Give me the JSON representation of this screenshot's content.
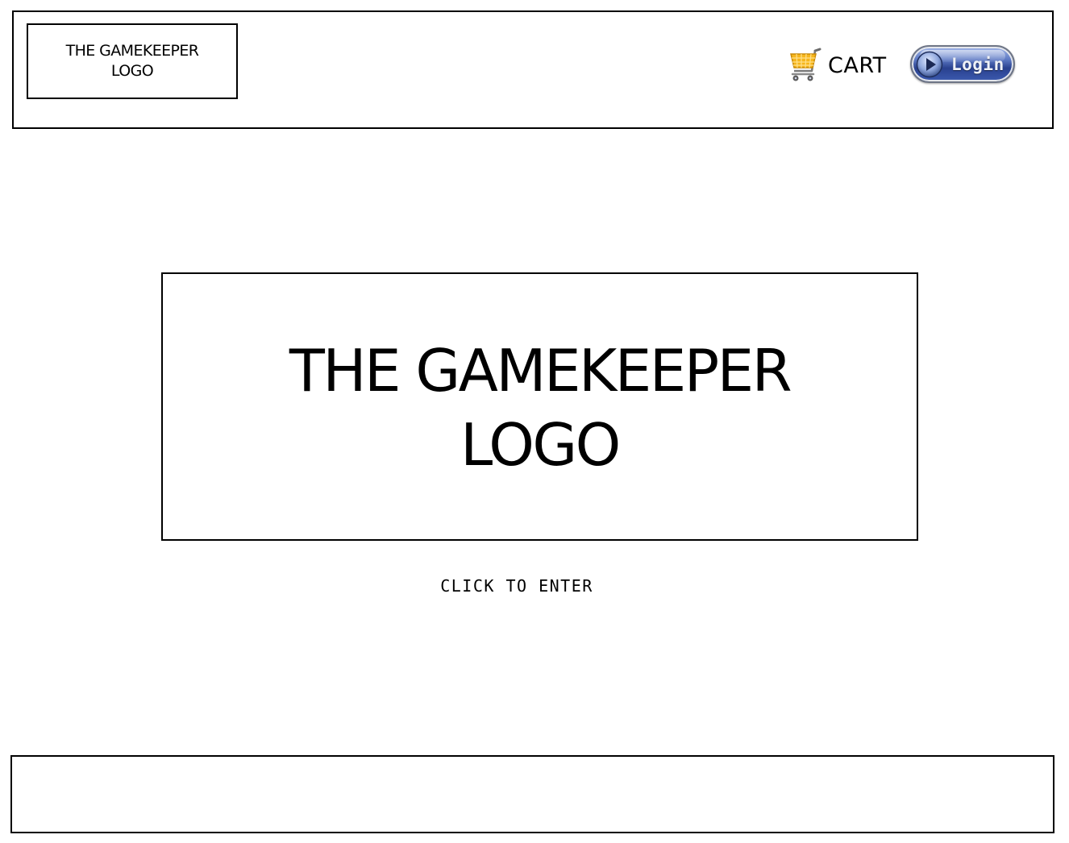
{
  "header": {
    "logo": {
      "line1": "THE GAMEKEEPER",
      "line2": "LOGO"
    },
    "cart": {
      "icon": "shopping-cart-icon",
      "label": "CART"
    },
    "login": {
      "icon": "play-icon",
      "label": "Login"
    }
  },
  "main": {
    "logo": {
      "line1": "THE GAMEKEEPER",
      "line2": "LOGO"
    },
    "enter_link": "CLICK TO ENTER"
  },
  "colors": {
    "border": "#000000",
    "background": "#ffffff",
    "cart_accent": "#f5b21a",
    "login_button": "#2f4a9e"
  }
}
